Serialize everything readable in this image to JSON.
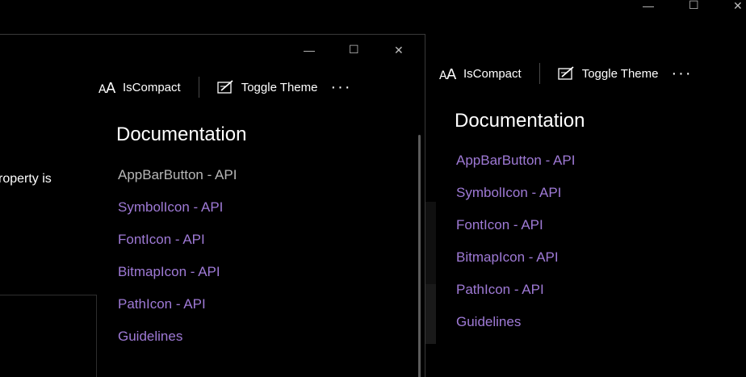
{
  "caption": {
    "minimize": "—",
    "maximize": "☐",
    "close": "✕"
  },
  "command_bar": {
    "is_compact_label": "IsCompact",
    "toggle_theme_label": "Toggle Theme",
    "more": "···",
    "is_compact_icon": "font-size-icon",
    "toggle_theme_icon": "edit-theme-icon"
  },
  "documentation": {
    "title": "Documentation",
    "links": [
      {
        "label": "AppBarButton - API"
      },
      {
        "label": "SymbolIcon - API"
      },
      {
        "label": "FontIcon - API"
      },
      {
        "label": "BitmapIcon - API"
      },
      {
        "label": "PathIcon - API"
      },
      {
        "label": "Guidelines"
      }
    ]
  },
  "foreground": {
    "snippet_text": "roperty is"
  },
  "colors": {
    "link": "#9f7ad6",
    "visited_link": "#b7b7b7",
    "background": "#000000"
  }
}
